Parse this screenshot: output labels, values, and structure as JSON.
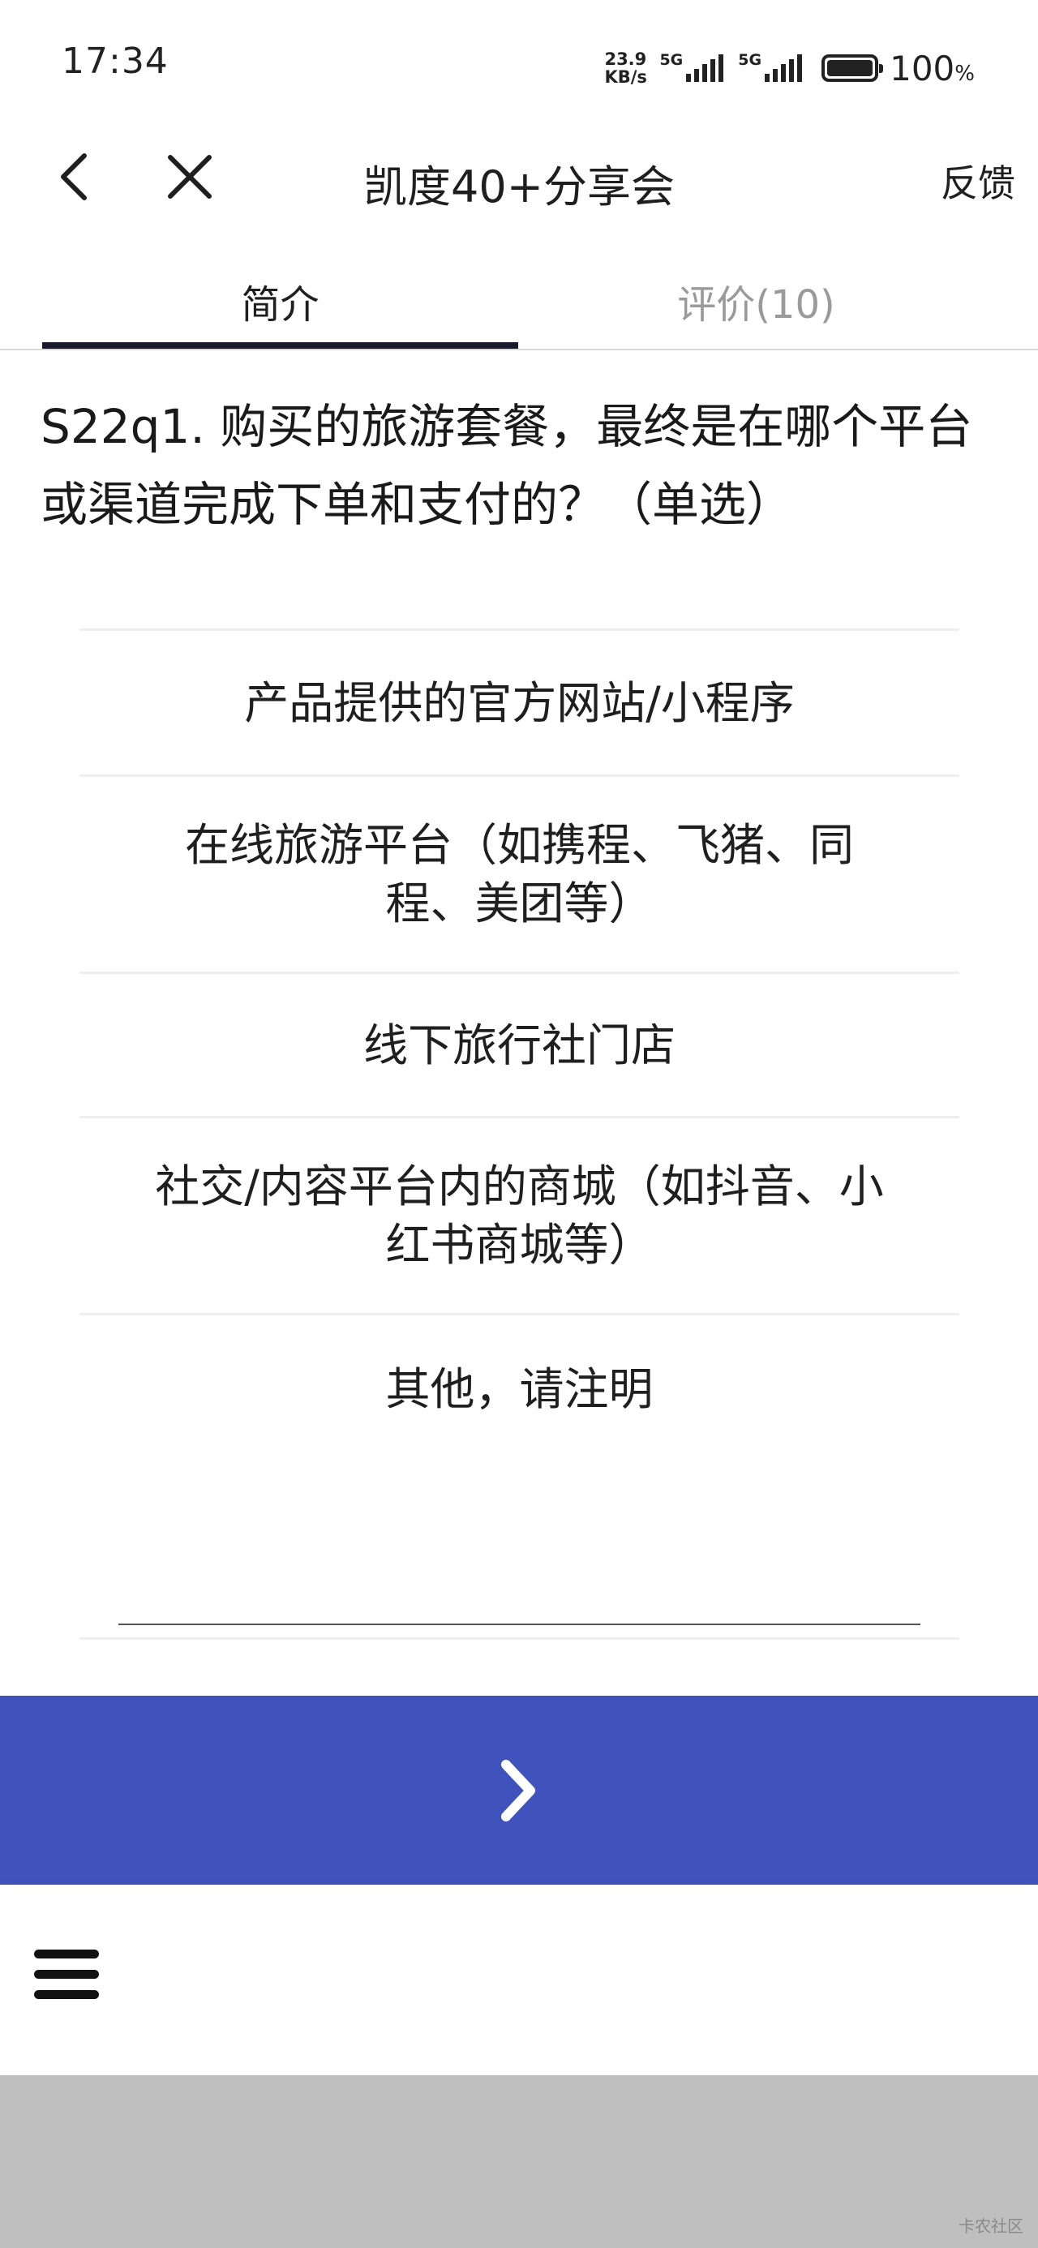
{
  "status_bar": {
    "time": "17:34",
    "net_speed_value": "23.9",
    "net_speed_unit": "KB/s",
    "sim1_tag": "5G",
    "sim2_tag": "5G",
    "battery_percent": "100",
    "battery_unit": "%"
  },
  "nav": {
    "title": "凯度40+分享会",
    "feedback_label": "反馈",
    "back_icon": "chevron-left-icon",
    "close_icon": "close-icon"
  },
  "tabs": [
    {
      "label": "简介",
      "active": true
    },
    {
      "label": "评价(10)",
      "active": false
    }
  ],
  "question": {
    "text": "S22q1. 购买的旅游套餐，最终是在哪个平台或渠道完成下单和支付的？（单选）"
  },
  "options": [
    {
      "label": "产品提供的官方网站/小程序"
    },
    {
      "label": "在线旅游平台（如携程、飞猪、同程、美团等）"
    },
    {
      "label": "线下旅行社门店"
    },
    {
      "label": "社交/内容平台内的商城（如抖音、小红书商城等）"
    },
    {
      "label": "其他，请注明"
    }
  ],
  "other_input": {
    "value": ""
  },
  "next_button": {
    "icon": "chevron-right-icon",
    "color": "#4052bb"
  },
  "bottom_toolbar": {
    "menu_icon": "hamburger-menu-icon"
  },
  "watermark": {
    "text": "卡农社区"
  },
  "colors": {
    "accent": "#4052bb",
    "tab_indicator": "#1a1a2e",
    "inactive_tab": "#9a9a9a"
  }
}
